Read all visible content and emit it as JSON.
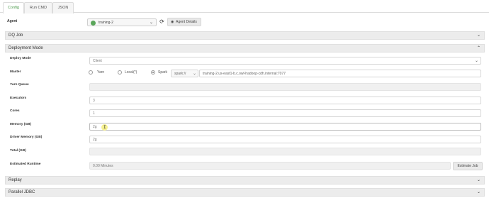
{
  "tabs": [
    {
      "label": "Config",
      "active": true
    },
    {
      "label": "Run CMD",
      "active": false
    },
    {
      "label": "JSON",
      "active": false
    }
  ],
  "agent": {
    "label": "Agent",
    "selected": "training-2",
    "status_color": "#5aa65a",
    "details_button": "Agent Details"
  },
  "sections": {
    "dq_job": "DQ Job",
    "deployment_mode": "Deployment Mode",
    "replay": "Replay",
    "parallel_jdbc": "Parallel JDBC"
  },
  "fields": {
    "deploy_mode": {
      "label": "Deploy Mode",
      "value": "Client"
    },
    "master": {
      "label": "Master",
      "options": [
        "Yarn",
        "Local(*)",
        "Spark"
      ],
      "selected": "Spark",
      "spark_prefix": "spark://",
      "spark_host": "training-2.us-east1-b.c.owl-hadoop-cdh.internal:7077"
    },
    "yarn_queue": {
      "label": "Yarn Queue",
      "value": ""
    },
    "executors": {
      "label": "Executors",
      "value": "3"
    },
    "cores": {
      "label": "Cores",
      "value": "1"
    },
    "memory": {
      "label": "Memory (GB)",
      "value": "2g"
    },
    "driver_memory": {
      "label": "Driver Memory (GB)",
      "value": "2g"
    },
    "total": {
      "label": "Total (GB)",
      "value": ""
    },
    "estimated_runtime": {
      "label": "Estimated Runtime",
      "value": "0.00 Minutes",
      "button": "Estimate Job"
    }
  },
  "icons": {
    "caret_down": "⌄",
    "caret_up": "⌃",
    "refresh": "⟳",
    "eye": "◉",
    "cursor": "I"
  }
}
